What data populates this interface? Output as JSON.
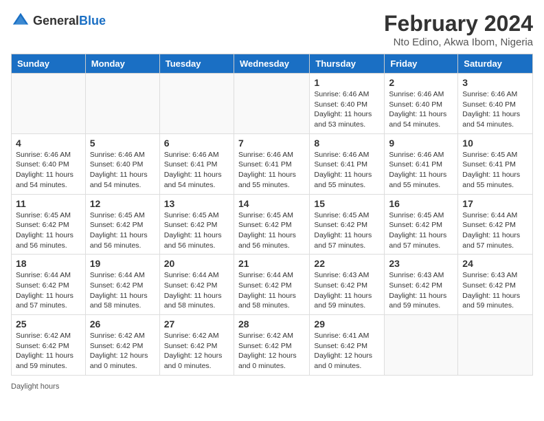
{
  "header": {
    "logo_general": "General",
    "logo_blue": "Blue",
    "main_title": "February 2024",
    "subtitle": "Nto Edino, Akwa Ibom, Nigeria"
  },
  "days_of_week": [
    "Sunday",
    "Monday",
    "Tuesday",
    "Wednesday",
    "Thursday",
    "Friday",
    "Saturday"
  ],
  "weeks": [
    [
      {
        "day": "",
        "info": ""
      },
      {
        "day": "",
        "info": ""
      },
      {
        "day": "",
        "info": ""
      },
      {
        "day": "",
        "info": ""
      },
      {
        "day": "1",
        "info": "Sunrise: 6:46 AM\nSunset: 6:40 PM\nDaylight: 11 hours and 53 minutes."
      },
      {
        "day": "2",
        "info": "Sunrise: 6:46 AM\nSunset: 6:40 PM\nDaylight: 11 hours and 54 minutes."
      },
      {
        "day": "3",
        "info": "Sunrise: 6:46 AM\nSunset: 6:40 PM\nDaylight: 11 hours and 54 minutes."
      }
    ],
    [
      {
        "day": "4",
        "info": "Sunrise: 6:46 AM\nSunset: 6:40 PM\nDaylight: 11 hours and 54 minutes."
      },
      {
        "day": "5",
        "info": "Sunrise: 6:46 AM\nSunset: 6:40 PM\nDaylight: 11 hours and 54 minutes."
      },
      {
        "day": "6",
        "info": "Sunrise: 6:46 AM\nSunset: 6:41 PM\nDaylight: 11 hours and 54 minutes."
      },
      {
        "day": "7",
        "info": "Sunrise: 6:46 AM\nSunset: 6:41 PM\nDaylight: 11 hours and 55 minutes."
      },
      {
        "day": "8",
        "info": "Sunrise: 6:46 AM\nSunset: 6:41 PM\nDaylight: 11 hours and 55 minutes."
      },
      {
        "day": "9",
        "info": "Sunrise: 6:46 AM\nSunset: 6:41 PM\nDaylight: 11 hours and 55 minutes."
      },
      {
        "day": "10",
        "info": "Sunrise: 6:45 AM\nSunset: 6:41 PM\nDaylight: 11 hours and 55 minutes."
      }
    ],
    [
      {
        "day": "11",
        "info": "Sunrise: 6:45 AM\nSunset: 6:42 PM\nDaylight: 11 hours and 56 minutes."
      },
      {
        "day": "12",
        "info": "Sunrise: 6:45 AM\nSunset: 6:42 PM\nDaylight: 11 hours and 56 minutes."
      },
      {
        "day": "13",
        "info": "Sunrise: 6:45 AM\nSunset: 6:42 PM\nDaylight: 11 hours and 56 minutes."
      },
      {
        "day": "14",
        "info": "Sunrise: 6:45 AM\nSunset: 6:42 PM\nDaylight: 11 hours and 56 minutes."
      },
      {
        "day": "15",
        "info": "Sunrise: 6:45 AM\nSunset: 6:42 PM\nDaylight: 11 hours and 57 minutes."
      },
      {
        "day": "16",
        "info": "Sunrise: 6:45 AM\nSunset: 6:42 PM\nDaylight: 11 hours and 57 minutes."
      },
      {
        "day": "17",
        "info": "Sunrise: 6:44 AM\nSunset: 6:42 PM\nDaylight: 11 hours and 57 minutes."
      }
    ],
    [
      {
        "day": "18",
        "info": "Sunrise: 6:44 AM\nSunset: 6:42 PM\nDaylight: 11 hours and 57 minutes."
      },
      {
        "day": "19",
        "info": "Sunrise: 6:44 AM\nSunset: 6:42 PM\nDaylight: 11 hours and 58 minutes."
      },
      {
        "day": "20",
        "info": "Sunrise: 6:44 AM\nSunset: 6:42 PM\nDaylight: 11 hours and 58 minutes."
      },
      {
        "day": "21",
        "info": "Sunrise: 6:44 AM\nSunset: 6:42 PM\nDaylight: 11 hours and 58 minutes."
      },
      {
        "day": "22",
        "info": "Sunrise: 6:43 AM\nSunset: 6:42 PM\nDaylight: 11 hours and 59 minutes."
      },
      {
        "day": "23",
        "info": "Sunrise: 6:43 AM\nSunset: 6:42 PM\nDaylight: 11 hours and 59 minutes."
      },
      {
        "day": "24",
        "info": "Sunrise: 6:43 AM\nSunset: 6:42 PM\nDaylight: 11 hours and 59 minutes."
      }
    ],
    [
      {
        "day": "25",
        "info": "Sunrise: 6:42 AM\nSunset: 6:42 PM\nDaylight: 11 hours and 59 minutes."
      },
      {
        "day": "26",
        "info": "Sunrise: 6:42 AM\nSunset: 6:42 PM\nDaylight: 12 hours and 0 minutes."
      },
      {
        "day": "27",
        "info": "Sunrise: 6:42 AM\nSunset: 6:42 PM\nDaylight: 12 hours and 0 minutes."
      },
      {
        "day": "28",
        "info": "Sunrise: 6:42 AM\nSunset: 6:42 PM\nDaylight: 12 hours and 0 minutes."
      },
      {
        "day": "29",
        "info": "Sunrise: 6:41 AM\nSunset: 6:42 PM\nDaylight: 12 hours and 0 minutes."
      },
      {
        "day": "",
        "info": ""
      },
      {
        "day": "",
        "info": ""
      }
    ]
  ],
  "footer": {
    "daylight_label": "Daylight hours"
  }
}
